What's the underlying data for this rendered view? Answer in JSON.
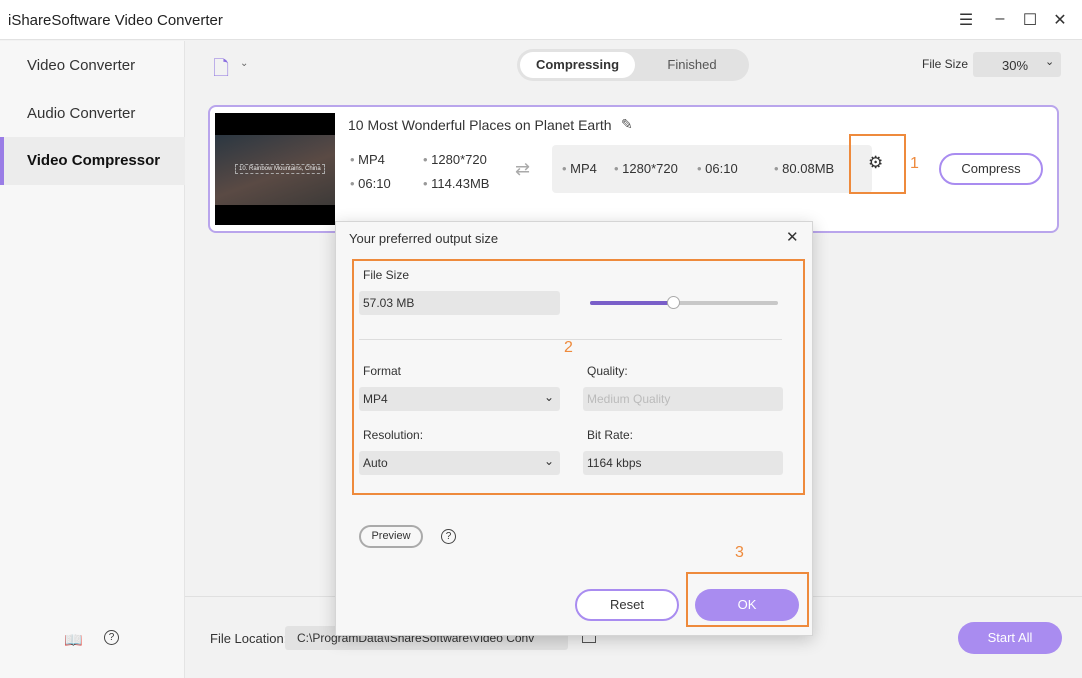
{
  "app": {
    "title": "iShareSoftware Video Converter"
  },
  "window": {
    "menu_icon": "hamburger-icon",
    "minimize_icon": "minimize-icon",
    "maximize_icon": "maximize-icon",
    "close_icon": "close-icon"
  },
  "sidebar": {
    "items": [
      {
        "label": "Video Converter"
      },
      {
        "label": "Audio Converter"
      },
      {
        "label": "Video Compressor",
        "active": true
      }
    ]
  },
  "toolbar": {
    "tabs": [
      "Compressing",
      "Finished"
    ],
    "active_tab": "Compressing",
    "file_size_label": "File Size",
    "file_size_value": "30%"
  },
  "task": {
    "title": "10 Most Wonderful Places on Planet Earth",
    "thumbnail_caption": "10. Rainbow Mountains, China",
    "source": {
      "format": "MP4",
      "resolution": "1280*720",
      "duration": "06:10",
      "size": "114.43MB"
    },
    "output": {
      "format": "MP4",
      "resolution": "1280*720",
      "duration": "06:10",
      "size": "80.08MB"
    },
    "compress_label": "Compress"
  },
  "annotations": [
    "1",
    "2",
    "3"
  ],
  "dialog": {
    "title": "Your preferred output size",
    "file_size_label": "File Size",
    "file_size_value": "57.03 MB",
    "slider_percent": 44,
    "format_label": "Format",
    "format_value": "MP4",
    "quality_label": "Quality:",
    "quality_placeholder": "Medium Quality",
    "resolution_label": "Resolution:",
    "resolution_value": "Auto",
    "bitrate_label": "Bit Rate:",
    "bitrate_value": "1164 kbps",
    "preview_label": "Preview",
    "reset_label": "Reset",
    "ok_label": "OK"
  },
  "bottom": {
    "file_location_label": "File Location:",
    "file_location_value": "C:\\ProgramData\\iShareSoftware\\Video Conv",
    "start_all_label": "Start All"
  },
  "colors": {
    "accent": "#a98cf0",
    "highlight": "#ee8a3c"
  }
}
